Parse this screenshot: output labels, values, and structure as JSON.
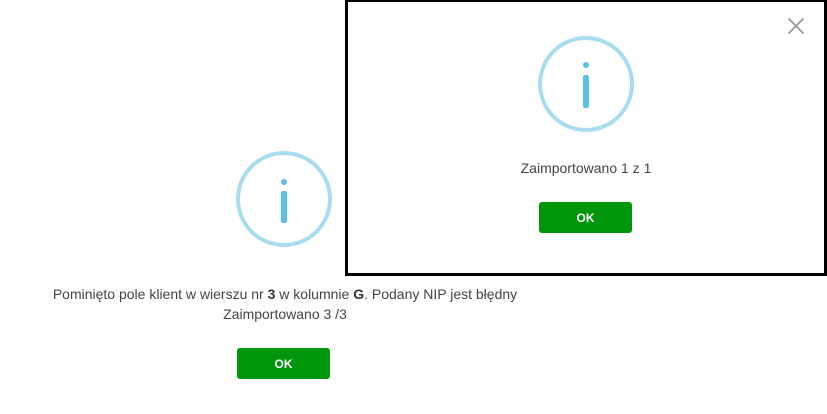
{
  "background_dialog": {
    "message_line1_part1": "Pominięto pole klient w wierszu nr ",
    "row_number": "3",
    "message_line1_part2": " w kolumnie ",
    "column_letter": "G",
    "message_line1_part3": ". Podany NIP jest błędny",
    "message_line2": "Zaimportowano 3 /3",
    "ok_label": "OK",
    "icon": "info-icon"
  },
  "modal": {
    "message": "Zaimportowano 1 z 1",
    "ok_label": "OK",
    "icon": "info-icon",
    "close_icon": "close-icon"
  },
  "colors": {
    "ok_button": "#00960c",
    "icon_ring": "#a8dcef",
    "icon_glyph": "#5bc0e6",
    "modal_border": "#000000"
  }
}
